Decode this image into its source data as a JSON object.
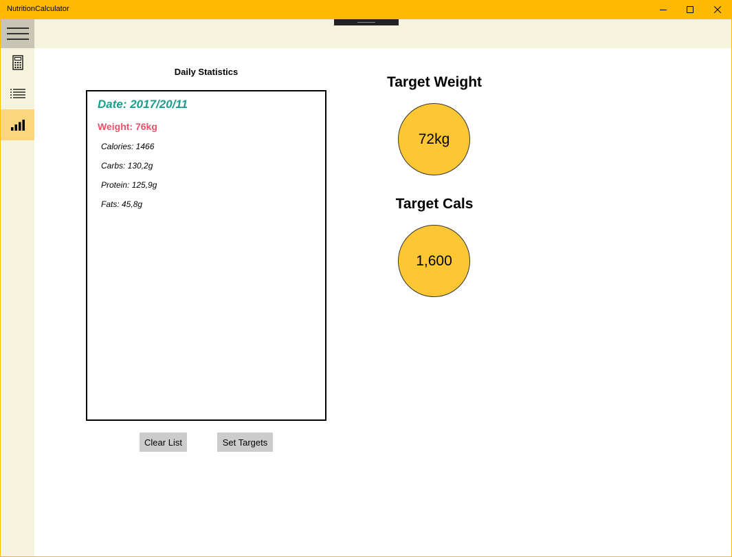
{
  "window": {
    "title": "NutritionCalculator"
  },
  "sidebar": {
    "items": [
      {
        "icon": "hamburger-menu-icon"
      },
      {
        "icon": "calculator-icon"
      },
      {
        "icon": "list-icon"
      },
      {
        "icon": "bar-chart-icon",
        "selected": true
      }
    ]
  },
  "main": {
    "heading": "Daily Statistics",
    "date": "Date: 2017/20/11",
    "weight": "Weight: 76kg",
    "calories": "Calories: 1466",
    "carbs": "Carbs: 130,2g",
    "protein": "Protein: 125,9g",
    "fats": "Fats: 45,8g",
    "clear_label": "Clear List",
    "targets_label": "Set Targets"
  },
  "targets": {
    "weight_label": "Target Weight",
    "weight_value": "72kg",
    "cals_label": "Target Cals",
    "cals_value": "1,600"
  },
  "colors": {
    "accent": "#ffb900",
    "sidebar_bg": "#f6f3dd",
    "selected_nav": "#fcd67e",
    "circle_fill": "#fdc733",
    "date_color": "#1a9e8c",
    "weight_color": "#e8516a"
  }
}
